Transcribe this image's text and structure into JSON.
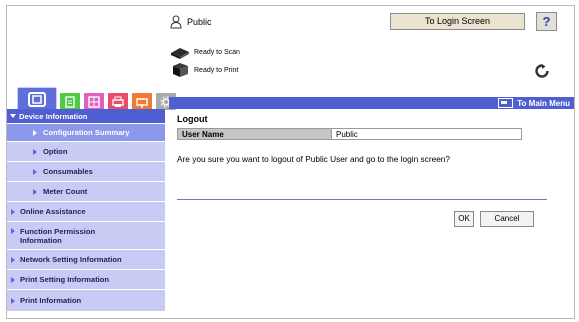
{
  "header": {
    "user_name": "Public",
    "login_button": "To Login Screen",
    "help_label": "?",
    "user_icon": "user-icon",
    "refresh_icon": "refresh-icon"
  },
  "status": {
    "scan": "Ready to Scan",
    "print": "Ready to Print"
  },
  "tabs": [
    {
      "icon": "device-information-icon"
    },
    {
      "icon": "document-box-icon"
    },
    {
      "icon": "job-icon"
    },
    {
      "icon": "print-icon"
    },
    {
      "icon": "fax-icon"
    },
    {
      "icon": "settings-icon"
    }
  ],
  "to_main_menu": "To Main Menu",
  "sidebar": {
    "items": [
      {
        "label": "Device Information"
      },
      {
        "label": "Configuration Summary"
      },
      {
        "label": "Option"
      },
      {
        "label": "Consumables"
      },
      {
        "label": "Meter Count"
      },
      {
        "label": "Online Assistance"
      },
      {
        "label": "Function Permission Information"
      },
      {
        "label": "Network Setting Information"
      },
      {
        "label": "Print Setting Information"
      },
      {
        "label": "Print Information"
      }
    ]
  },
  "main": {
    "title": "Logout",
    "user_name_label": "User Name",
    "user_name_value": "Public",
    "question": "Are you sure you want to logout of Public User and go to the login screen?",
    "ok_label": "OK",
    "cancel_label": "Cancel"
  },
  "colors": {
    "accent": "#4f5fd1",
    "sidebar_bg": "#c9cbf4",
    "sidebar_active": "#8d98ea"
  }
}
